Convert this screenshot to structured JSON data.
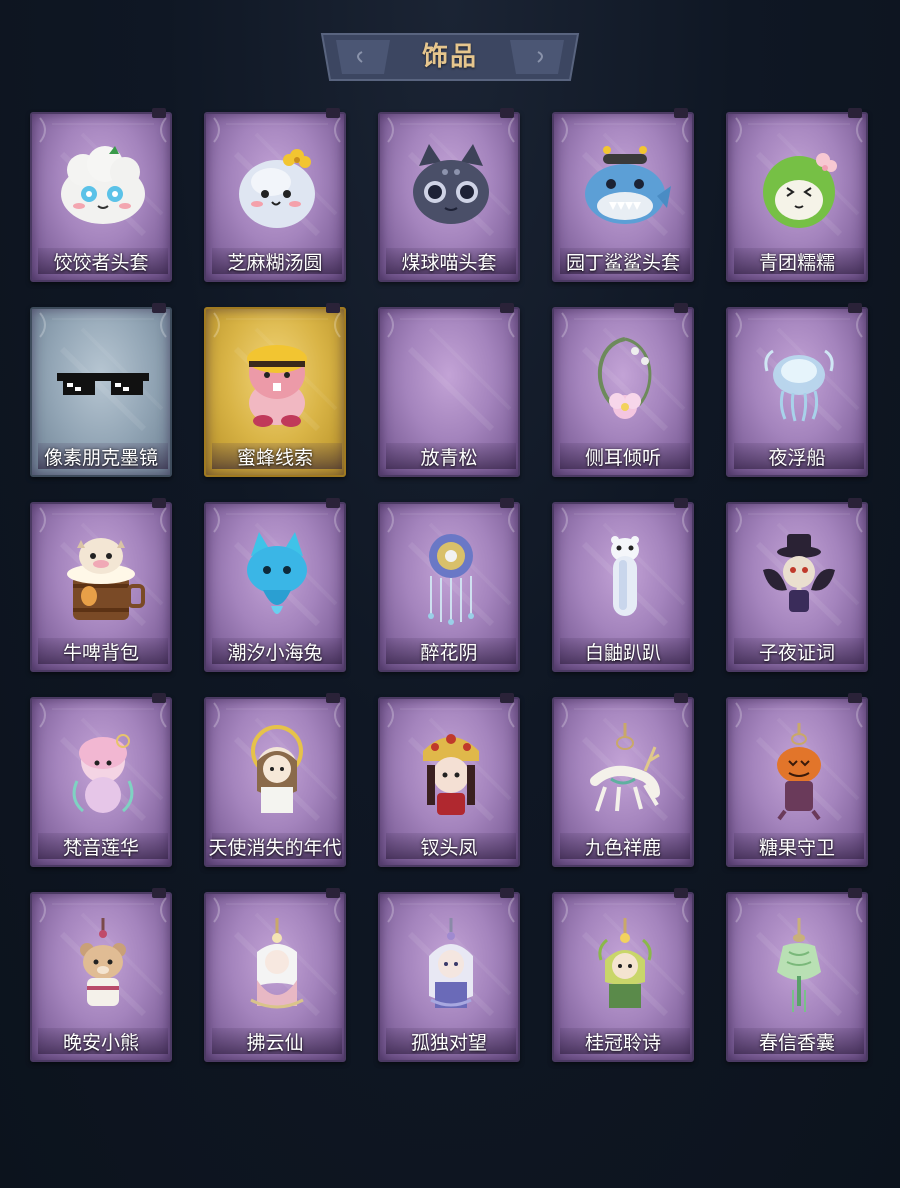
{
  "header": {
    "title": "饰品"
  },
  "colors": {
    "background": "#0e1622",
    "title_text": "#e6c68e",
    "card_purple": "#a484bd",
    "card_blue": "#93a6b6",
    "card_gold": "#d9b446"
  },
  "items": [
    {
      "name": "饺饺者头套",
      "rarity": "purple",
      "icon": "dumpling-mask-icon"
    },
    {
      "name": "芝麻糊汤圆",
      "rarity": "purple",
      "icon": "rice-ball-mask-icon"
    },
    {
      "name": "煤球喵头套",
      "rarity": "purple",
      "icon": "black-cat-mask-icon"
    },
    {
      "name": "园丁鲨鲨头套",
      "rarity": "purple",
      "icon": "shark-mask-icon"
    },
    {
      "name": "青团糯糯",
      "rarity": "purple",
      "icon": "green-rice-ball-icon"
    },
    {
      "name": "像素朋克墨镜",
      "rarity": "blue",
      "icon": "pixel-sunglasses-icon"
    },
    {
      "name": "蜜蜂线索",
      "rarity": "gold",
      "icon": "bee-beaver-icon"
    },
    {
      "name": "放青松",
      "rarity": "purple",
      "icon": "empty-slot-icon"
    },
    {
      "name": "侧耳倾听",
      "rarity": "purple",
      "icon": "flower-wreath-icon"
    },
    {
      "name": "夜浮船",
      "rarity": "purple",
      "icon": "jellyfish-icon"
    },
    {
      "name": "牛啤背包",
      "rarity": "purple",
      "icon": "cow-beer-barrel-icon"
    },
    {
      "name": "潮汐小海兔",
      "rarity": "purple",
      "icon": "sea-bunny-icon"
    },
    {
      "name": "醉花阴",
      "rarity": "purple",
      "icon": "flower-headdress-icon"
    },
    {
      "name": "白鼬趴趴",
      "rarity": "purple",
      "icon": "white-weasel-icon"
    },
    {
      "name": "子夜证词",
      "rarity": "purple",
      "icon": "plague-crow-icon"
    },
    {
      "name": "梵音莲华",
      "rarity": "purple",
      "icon": "lotus-doll-icon"
    },
    {
      "name": "天使消失的年代",
      "rarity": "purple",
      "icon": "angel-doll-icon"
    },
    {
      "name": "钗头凤",
      "rarity": "purple",
      "icon": "phoenix-crown-doll-icon"
    },
    {
      "name": "九色祥鹿",
      "rarity": "purple",
      "icon": "deer-charm-icon"
    },
    {
      "name": "糖果守卫",
      "rarity": "purple",
      "icon": "pumpkin-charm-icon"
    },
    {
      "name": "晚安小熊",
      "rarity": "purple",
      "icon": "bear-charm-icon"
    },
    {
      "name": "拂云仙",
      "rarity": "purple",
      "icon": "cloud-fairy-charm-icon"
    },
    {
      "name": "孤独对望",
      "rarity": "purple",
      "icon": "lonely-gaze-charm-icon"
    },
    {
      "name": "桂冠聆诗",
      "rarity": "purple",
      "icon": "laurel-poet-charm-icon"
    },
    {
      "name": "春信香囊",
      "rarity": "purple",
      "icon": "sachet-charm-icon"
    }
  ]
}
